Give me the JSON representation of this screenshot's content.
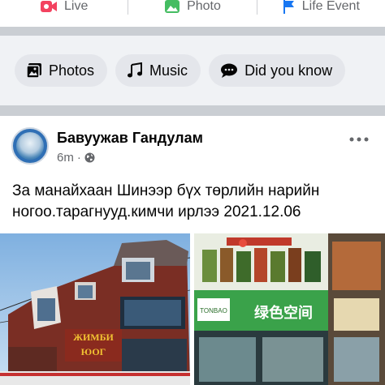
{
  "composer": {
    "live_label": "Live",
    "photo_label": "Photo",
    "life_event_label": "Life Event"
  },
  "chips": [
    {
      "label": "Photos",
      "icon": "photos-icon"
    },
    {
      "label": "Music",
      "icon": "music-note-icon"
    },
    {
      "label": "Did you know",
      "icon": "speech-bubble-icon"
    }
  ],
  "post": {
    "author": "Бавуужав Гандулам",
    "time": "6m",
    "separator": "·",
    "privacy_icon": "globe-icon",
    "text": "За манайхаан Шинээр бүх төрлийн нарийн ногоо.тарагнууд.кимчи  ирлээ  2021.12.06",
    "photos": [
      {
        "sign_text_1": "ЖИМБИ",
        "sign_text_2": "ЮОГ"
      },
      {
        "sign_text": "TONBAO",
        "sign_text_2": "绿色空间"
      }
    ]
  },
  "colors": {
    "accent": "#1877f2",
    "secondary_text": "#65676b",
    "chip_bg": "#e4e6eb",
    "feed_bg": "#f0f2f5"
  }
}
